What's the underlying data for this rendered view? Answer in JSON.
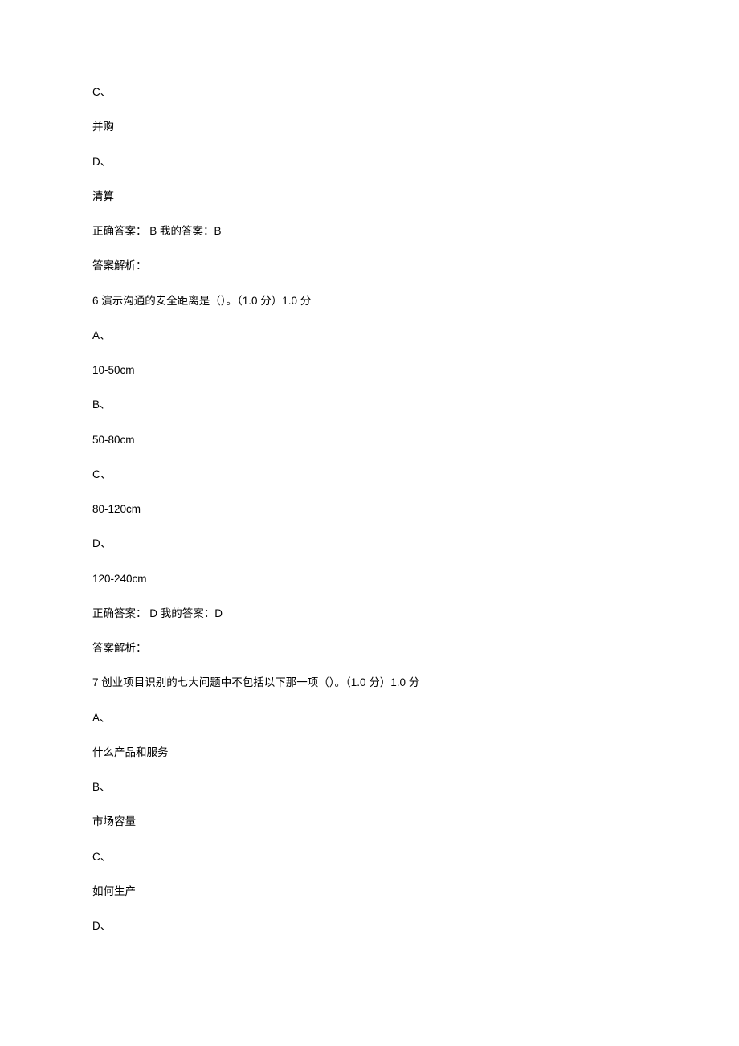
{
  "lines": [
    "C、",
    "并购",
    "D、",
    "清算",
    "正确答案： B  我的答案：B",
    "答案解析：",
    "6 演示沟通的安全距离是（）。（1.0 分）1.0  分",
    "A、",
    "10-50cm",
    "B、",
    "50-80cm",
    "C、",
    "80-120cm",
    "D、",
    "120-240cm",
    "正确答案： D  我的答案：D",
    "答案解析：",
    "7 创业项目识别的七大问题中不包括以下那一项（）。（1.0 分）1.0  分",
    "A、",
    "什么产品和服务",
    "B、",
    "市场容量",
    "C、",
    "如何生产",
    "D、"
  ]
}
